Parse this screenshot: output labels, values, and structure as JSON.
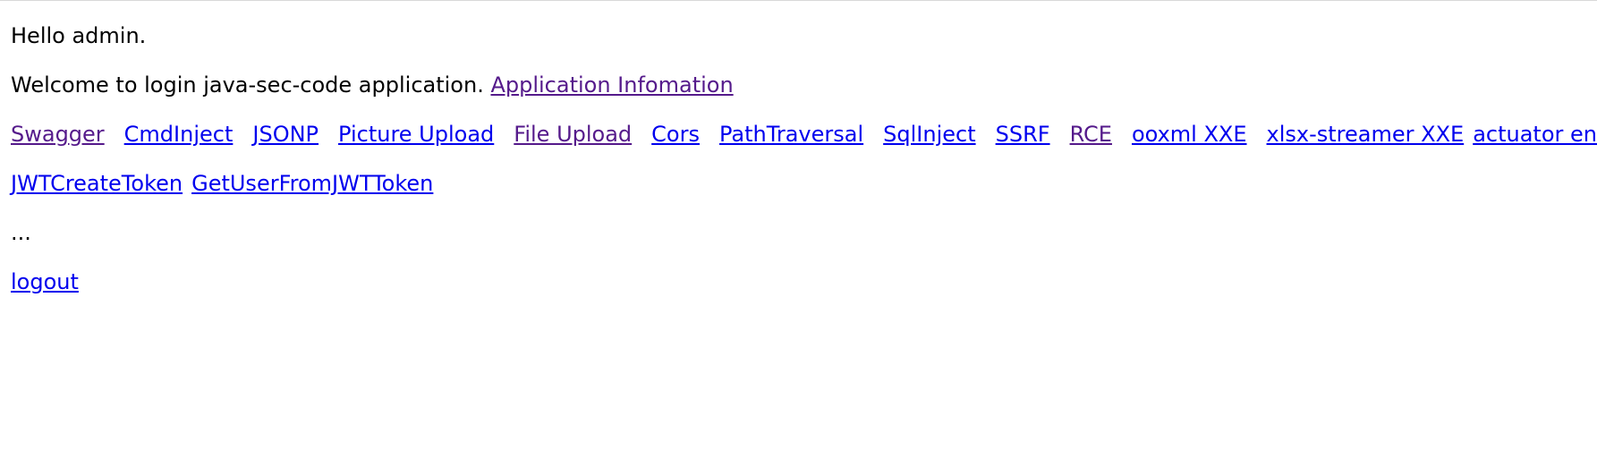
{
  "greeting": "Hello admin.",
  "welcome": {
    "text": "Welcome to login java-sec-code application. ",
    "info_link": "Application Infomation"
  },
  "links": [
    {
      "label": "Swagger",
      "visited": true
    },
    {
      "label": "CmdInject",
      "visited": false
    },
    {
      "label": "JSONP",
      "visited": false
    },
    {
      "label": "Picture Upload",
      "visited": false
    },
    {
      "label": "File Upload",
      "visited": true
    },
    {
      "label": "Cors",
      "visited": false
    },
    {
      "label": "PathTraversal",
      "visited": false
    },
    {
      "label": "SqlInject",
      "visited": false
    },
    {
      "label": "SSRF",
      "visited": false
    },
    {
      "label": "RCE",
      "visited": true
    },
    {
      "label": "ooxml XXE",
      "visited": false
    },
    {
      "label": "xlsx-streamer XXE",
      "visited": false
    },
    {
      "label": "actuator env",
      "visited": false
    }
  ],
  "jwt_links": [
    {
      "label": "JWTCreateToken"
    },
    {
      "label": "GetUserFromJWTToken"
    }
  ],
  "ellipsis": "...",
  "logout": "logout",
  "colors": {
    "link": "#0000ee",
    "visited_link": "#551a8b",
    "text": "#000000"
  }
}
